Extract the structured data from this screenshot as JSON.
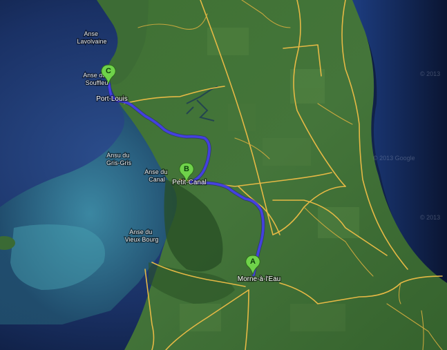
{
  "map": {
    "labels": {
      "anse_lavolvaine": [
        "Anse",
        "Lavolvaine"
      ],
      "anse_du_souffleur": [
        "Anse du",
        "Souffleu"
      ],
      "port_louis": "Port-Louis",
      "ansu_du_gris_gris": [
        "Ansu du",
        "Gris-Gris"
      ],
      "anse_du_canal": [
        "Anse du",
        "Canal"
      ],
      "petit_canal": "Petit-Canal",
      "anse_du_vieux_bourg": [
        "Anse du",
        "Vieux Bourg"
      ],
      "morne_a_l_eau": "Morne-à-l'Eau"
    },
    "markers": [
      {
        "letter": "A",
        "color": "#6fd24a"
      },
      {
        "letter": "B",
        "color": "#6fd24a"
      },
      {
        "letter": "C",
        "color": "#6fd24a"
      }
    ],
    "watermarks": [
      "© 2013",
      "© 2013 Google",
      "© 2013"
    ],
    "colors": {
      "ocean_deep": "#0d1b3a",
      "shallow_water": "#2c6f8c",
      "land": "#3b6a32",
      "road": "#e6b945",
      "route": "#4640e6",
      "marker": "#6fd24a"
    }
  }
}
